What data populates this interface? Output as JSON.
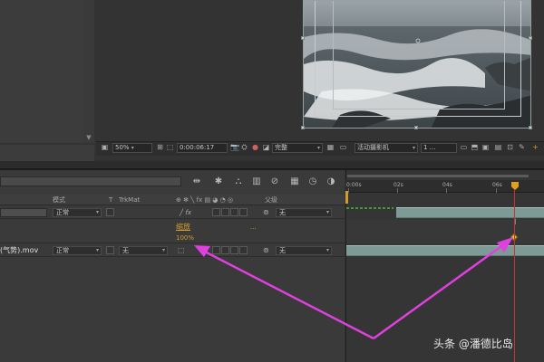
{
  "viewer": {
    "zoom": "50%",
    "timecode": "0:00:06:17",
    "resolution": "完整",
    "camera": "活动摄影机",
    "views": "1 ...",
    "caret": "▾"
  },
  "timeline": {
    "columns": {
      "mode": "模式",
      "t": "T",
      "trkmat": "TrkMat",
      "switches": "⊕ ✻ ╲ fx ▤ ◕ ◔ ◎",
      "parent": "父级"
    },
    "ruler_labels": [
      "0:00s",
      "02s",
      "04s",
      "06s"
    ],
    "layers": [
      {
        "name": "",
        "mode": "正常",
        "parent": "无"
      },
      {
        "property_name": "缩放",
        "property_value": "100%",
        "ellipsis": "..."
      },
      {
        "name": "(气势).mov",
        "mode": "正常",
        "trkmat": "无",
        "parent": "无"
      }
    ]
  },
  "icons": {
    "snapshot": "camera-icon",
    "color": "color-channels-icon",
    "search": "search-icon"
  },
  "watermark": "头条 @潘德比岛",
  "colors": {
    "accent": "#d39b2c",
    "cti": "#c83232",
    "arrow": "#e040e0",
    "layer_bar": "#7e9a96"
  }
}
